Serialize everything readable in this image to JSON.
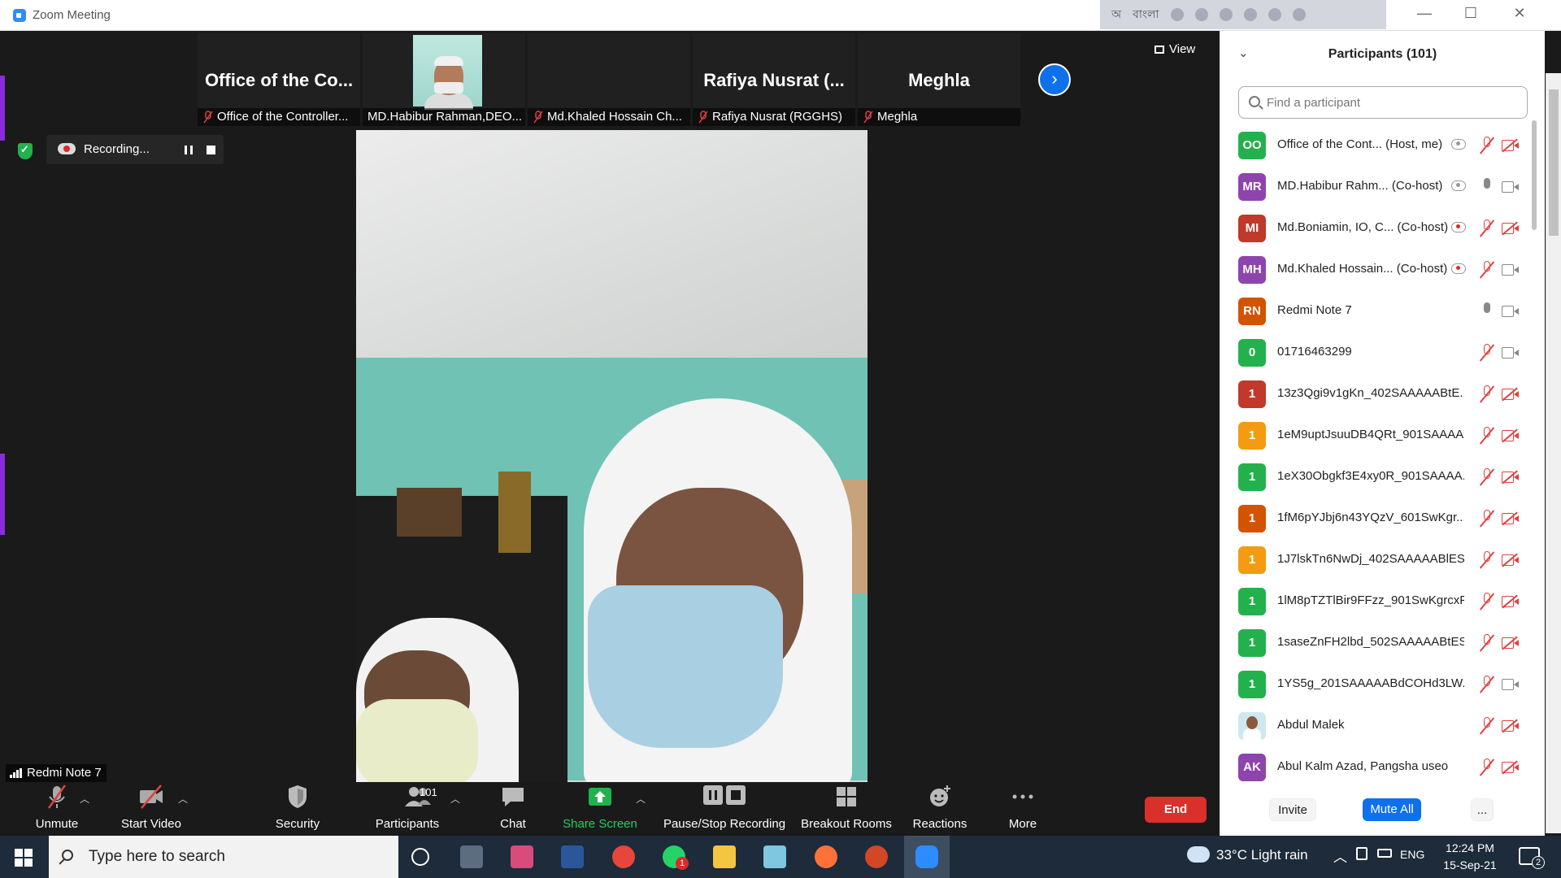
{
  "window": {
    "title": "Zoom Meeting",
    "ime": {
      "lang": "বাংলা"
    }
  },
  "gallery": {
    "thumbs": [
      {
        "big": "Office of the Co...",
        "caption": "Office of the Controller...",
        "video": false
      },
      {
        "big": "",
        "caption": "MD.Habibur Rahman,DEO...",
        "video": true
      },
      {
        "big": "",
        "caption": "Md.Khaled Hossain Ch...",
        "video": false
      },
      {
        "big": "Rafiya Nusrat (...",
        "caption": "Rafiya Nusrat (RGGHS)",
        "video": false
      },
      {
        "big": "Meghla",
        "caption": "Meghla",
        "video": false
      }
    ],
    "view_label": "View"
  },
  "recording": {
    "label": "Recording..."
  },
  "active_speaker": {
    "name": "Redmi Note 7"
  },
  "toolbar": {
    "unmute": "Unmute",
    "start_video": "Start Video",
    "security": "Security",
    "participants": "Participants",
    "participants_count": "101",
    "chat": "Chat",
    "share_screen": "Share Screen",
    "pause_stop_recording": "Pause/Stop Recording",
    "breakout_rooms": "Breakout Rooms",
    "reactions": "Reactions",
    "more": "More",
    "end": "End"
  },
  "participants_panel": {
    "title": "Participants (101)",
    "search_placeholder": "Find a participant",
    "invite": "Invite",
    "mute_all": "Mute All",
    "more": "...",
    "items": [
      {
        "initials": "OO",
        "color": "#23b14d",
        "name": "Office of the Cont...  (Host, me)",
        "rec": "grey",
        "mic": "muted",
        "cam": "off"
      },
      {
        "initials": "MR",
        "color": "#8e44ad",
        "name": "MD.Habibur Rahm...  (Co-host)",
        "rec": "grey",
        "mic": "on",
        "cam": "on"
      },
      {
        "initials": "MI",
        "color": "#c0392b",
        "name": "Md.Boniamin, IO, C...  (Co-host)",
        "rec": "red",
        "mic": "muted",
        "cam": "off"
      },
      {
        "initials": "MH",
        "color": "#8e44ad",
        "name": "Md.Khaled Hossain...  (Co-host)",
        "rec": "red",
        "mic": "muted",
        "cam": "on"
      },
      {
        "initials": "RN",
        "color": "#d35400",
        "name": "Redmi Note 7",
        "rec": "",
        "mic": "on",
        "cam": "on"
      },
      {
        "initials": "0",
        "color": "#23b14d",
        "name": "01716463299",
        "rec": "",
        "mic": "muted",
        "cam": "on"
      },
      {
        "initials": "1",
        "color": "#c0392b",
        "name": "13z3Qgi9v1gKn_402SAAAAABtE...",
        "rec": "",
        "mic": "muted",
        "cam": "off"
      },
      {
        "initials": "1",
        "color": "#f39c12",
        "name": "1eM9uptJsuuDB4QRt_901SAAAA...",
        "rec": "",
        "mic": "muted",
        "cam": "off"
      },
      {
        "initials": "1",
        "color": "#23b14d",
        "name": "1eX30Obgkf3E4xy0R_901SAAAA...",
        "rec": "",
        "mic": "muted",
        "cam": "off"
      },
      {
        "initials": "1",
        "color": "#d35400",
        "name": "1fM6pYJbj6n43YQzV_601SwKgr...",
        "rec": "",
        "mic": "muted",
        "cam": "off"
      },
      {
        "initials": "1",
        "color": "#f39c12",
        "name": "1J7lskTn6NwDj_402SAAAAABlES...",
        "rec": "",
        "mic": "muted",
        "cam": "off"
      },
      {
        "initials": "1",
        "color": "#23b14d",
        "name": "1lM8pTZTlBir9FFzz_901SwKgrcxF...",
        "rec": "",
        "mic": "muted",
        "cam": "off"
      },
      {
        "initials": "1",
        "color": "#23b14d",
        "name": "1saseZnFH2lbd_502SAAAAABtES...",
        "rec": "",
        "mic": "muted",
        "cam": "off"
      },
      {
        "initials": "1",
        "color": "#23b14d",
        "name": "1YS5g_201SAAAAABdCOHd3LW...",
        "rec": "",
        "mic": "muted",
        "cam": "on"
      },
      {
        "initials": "",
        "color": "",
        "name": "Abdul Malek",
        "rec": "",
        "mic": "muted",
        "cam": "off",
        "photo": true
      },
      {
        "initials": "AK",
        "color": "#8e44ad",
        "name": "Abul Kalm Azad, Pangsha useo",
        "rec": "",
        "mic": "muted",
        "cam": "off"
      }
    ]
  },
  "taskbar": {
    "search_text": "Type here to search",
    "weather": "33°C  Light rain",
    "lang": "ENG",
    "time": "12:24 PM",
    "date": "15-Sep-21",
    "notifications": "2",
    "whatsapp_badge": "1"
  }
}
